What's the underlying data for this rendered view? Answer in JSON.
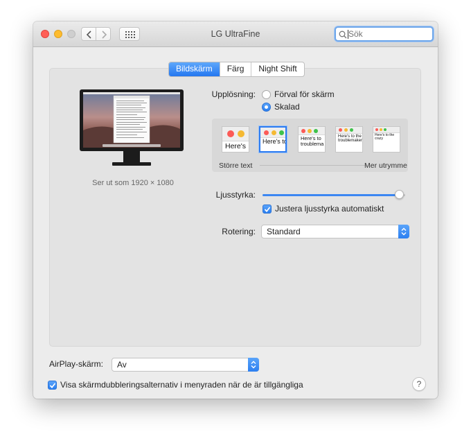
{
  "window": {
    "title": "LG UltraFine"
  },
  "toolbar": {
    "search_placeholder": "Sök"
  },
  "tabs": [
    {
      "label": "Bildskärm",
      "active": true
    },
    {
      "label": "Färg",
      "active": false
    },
    {
      "label": "Night Shift",
      "active": false
    }
  ],
  "display": {
    "looks_like": "Ser ut som 1920 × 1080"
  },
  "resolution": {
    "label": "Upplösning:",
    "options": [
      {
        "label": "Förval för skärm",
        "selected": false
      },
      {
        "label": "Skalad",
        "selected": true
      }
    ],
    "scale_thumbnails": [
      "Here's",
      "Here's to",
      "Here's to troublema",
      "Here's to the c troublemakers.",
      "Here's to the crazy"
    ],
    "selected_index": 1,
    "larger_text_label": "Större text",
    "more_space_label": "Mer utrymme"
  },
  "brightness": {
    "label": "Ljusstyrka:",
    "value_percent": 96,
    "auto_label": "Justera ljusstyrka automatiskt",
    "auto_checked": true
  },
  "rotation": {
    "label": "Rotering:",
    "value": "Standard"
  },
  "airplay": {
    "label": "AirPlay-skärm:",
    "value": "Av"
  },
  "mirroring_option": {
    "label": "Visa skärmdubbleringsalternativ i menyraden när de är tillgängliga",
    "checked": true
  },
  "help": {
    "label": "?"
  },
  "colors": {
    "accent": "#2e7cf0",
    "close": "#ff5f57",
    "minimize": "#febc2e"
  }
}
